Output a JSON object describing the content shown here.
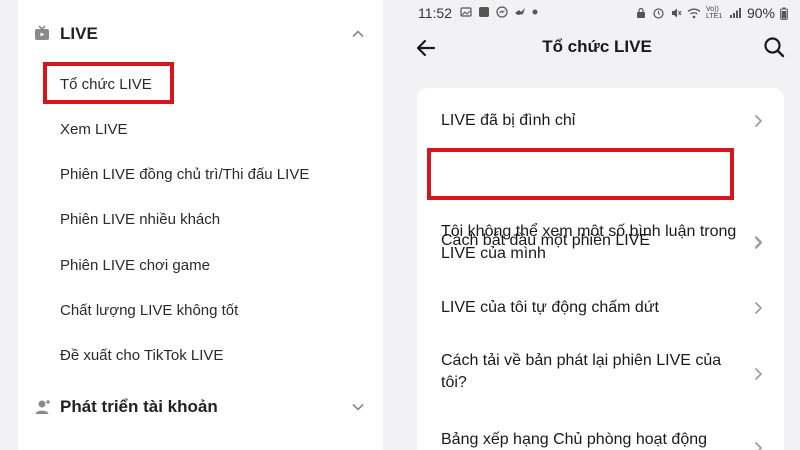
{
  "left_menu": {
    "section1": {
      "title": "LIVE"
    },
    "items": [
      {
        "label": "Tổ chức LIVE"
      },
      {
        "label": "Xem LIVE"
      },
      {
        "label": "Phiên LIVE đồng chủ trì/Thi đấu LIVE"
      },
      {
        "label": "Phiên LIVE nhiều khách"
      },
      {
        "label": "Phiên LIVE chơi game"
      },
      {
        "label": "Chất lượng LIVE không tốt"
      },
      {
        "label": "Đề xuất cho TikTok LIVE"
      }
    ],
    "section2": {
      "title": "Phát triển tài khoản"
    }
  },
  "status_bar": {
    "time": "11:52",
    "battery": "90%",
    "network": "Vo)) LTE1"
  },
  "nav": {
    "title": "Tổ chức LIVE"
  },
  "list": [
    {
      "label": "LIVE đã bị đình chỉ"
    },
    {
      "label": "Cách bắt đầu một phiên LIVE"
    },
    {
      "label": "Tôi không thể xem một số bình luận trong LIVE của mình"
    },
    {
      "label": "LIVE của tôi tự động chấm dứt"
    },
    {
      "label": "Cách tải về bản phát lại phiên LIVE của tôi?"
    },
    {
      "label": "Bảng xếp hạng Chủ phòng hoạt động"
    }
  ],
  "colors": {
    "highlight": "#d6151d",
    "chevron": "#9a9a9a"
  },
  "icons": {
    "live_section": "tv-icon",
    "account_section": "person-plus-icon",
    "collapse": "chevron-up-icon",
    "expand": "chevron-down-icon",
    "back": "arrow-left-icon",
    "search": "search-icon",
    "row": "chevron-right-icon"
  }
}
